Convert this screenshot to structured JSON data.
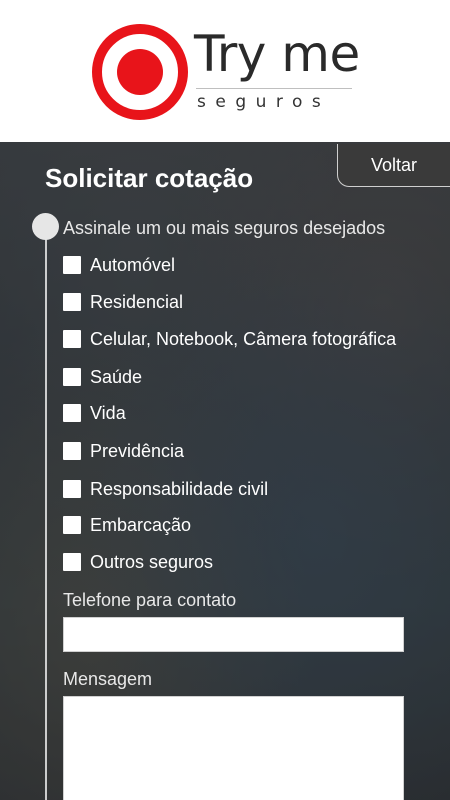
{
  "brand": {
    "title": "Try me",
    "subtitle": "seguros",
    "logo_colors": {
      "ring": "#e8141a",
      "dot": "#e8141a",
      "gap": "#ffffff"
    }
  },
  "form": {
    "title": "Solicitar cotação",
    "back_label": "Voltar",
    "instruction": "Assinale um ou mais seguros desejados",
    "options": [
      {
        "label": "Automóvel",
        "checked": false
      },
      {
        "label": "Residencial",
        "checked": false
      },
      {
        "label": "Celular, Notebook, Câmera fotográfica",
        "checked": false
      },
      {
        "label": "Saúde",
        "checked": false
      },
      {
        "label": "Vida",
        "checked": false
      },
      {
        "label": "Previdência",
        "checked": false
      },
      {
        "label": "Responsabilidade civil",
        "checked": false
      },
      {
        "label": "Embarcação",
        "checked": false
      },
      {
        "label": "Outros seguros",
        "checked": false
      }
    ],
    "phone_label": "Telefone para contato",
    "phone_value": "",
    "message_label": "Mensagem",
    "message_value": ""
  }
}
